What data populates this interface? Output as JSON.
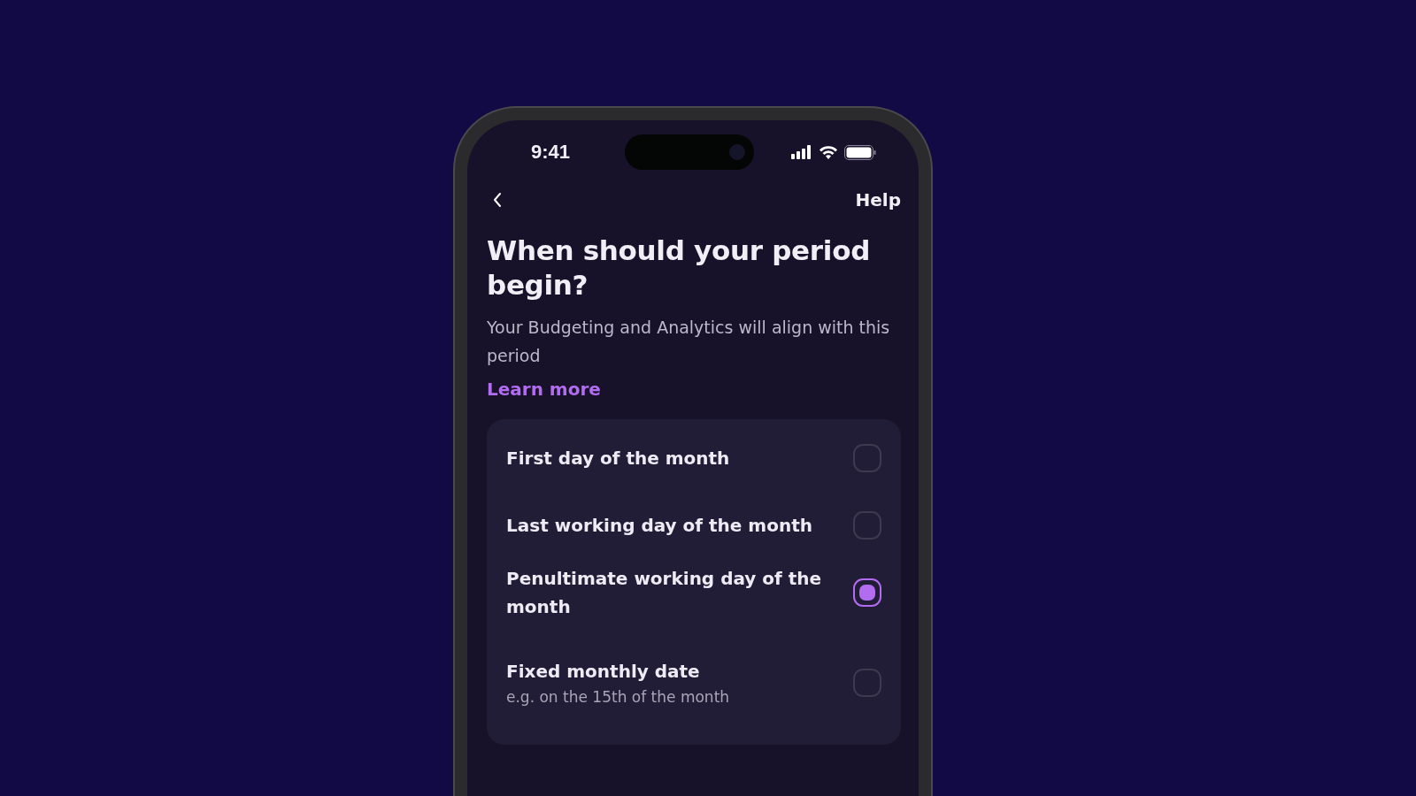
{
  "status_bar": {
    "time": "9:41"
  },
  "nav": {
    "help": "Help"
  },
  "title": "When should your period begin?",
  "subtitle": "Your Budgeting and Analytics will align with this period",
  "link": "Learn more",
  "options": [
    {
      "label": "First day of the month",
      "selected": false
    },
    {
      "label": "Last working day of the month",
      "selected": false
    },
    {
      "label": "Penultimate working day of the month",
      "selected": true
    },
    {
      "label": "Fixed monthly date",
      "hint": "e.g. on the 15th of the month",
      "selected": false
    }
  ]
}
